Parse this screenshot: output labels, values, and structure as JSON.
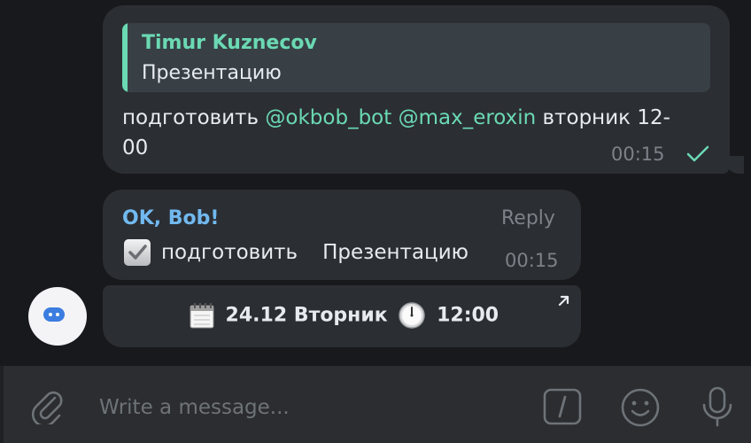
{
  "outgoing_message": {
    "quote_author": "Timur Kuznecov",
    "quote_text": "Презентацию",
    "text_start": "подготовить ",
    "mention_1": "@okbob_bot",
    "space": " ",
    "mention_2": "@max_eroxin",
    "text_end": " вторник 12-00",
    "time": "00:15",
    "status_icon": "check-icon"
  },
  "bot_message": {
    "sender": "OK, Bob!",
    "reply_label": "Reply",
    "task_action": "подготовить",
    "task_subject": "Презентацию",
    "time": "00:15",
    "checkbox_icon": "checkbox-checked-icon"
  },
  "keyboard_button": {
    "date": "24.12 Вторник",
    "time": "12:00",
    "calendar_icon": "calendar-icon",
    "clock_icon": "clock-icon",
    "link_icon": "arrow-up-right-icon"
  },
  "avatar": {
    "icon": "bot-icon"
  },
  "composer": {
    "placeholder": "Write a message...",
    "value": "",
    "icons": [
      "paperclip-icon",
      "bot-commands-icon",
      "emoji-icon",
      "microphone-icon"
    ]
  },
  "colors": {
    "background": "#18191d",
    "bubble": "#2b2e33",
    "accent_green": "#6bd9b3",
    "accent_blue": "#71b9ef",
    "muted": "#7d8288"
  }
}
